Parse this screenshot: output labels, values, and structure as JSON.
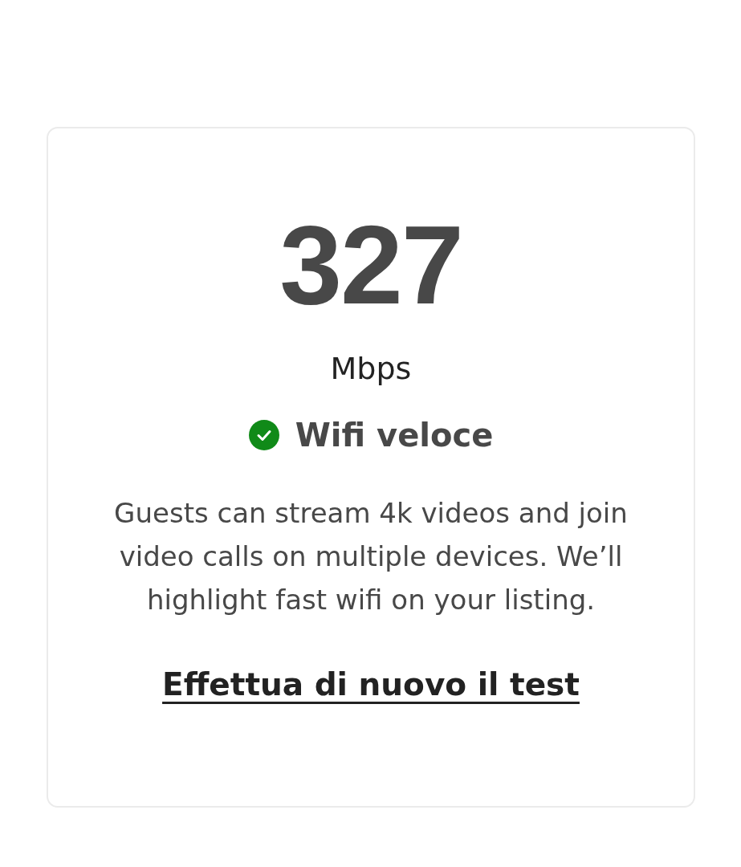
{
  "speed": {
    "value": "327",
    "unit": "Mbps"
  },
  "status": {
    "label": "Wifi veloce"
  },
  "description": "Guests can stream 4k videos and join video calls on multiple devices. We’ll highlight fast wifi on your listing.",
  "retest_link": "Effettua di nuovo il test"
}
